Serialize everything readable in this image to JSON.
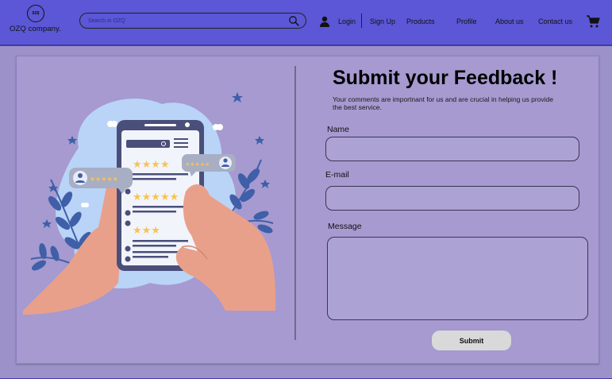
{
  "header": {
    "logo": {
      "mark_text": "OZQ",
      "name": "OZQ company."
    },
    "search": {
      "placeholder": "Search in OZQ"
    },
    "nav": {
      "login": "Login",
      "signup": "Sign Up",
      "products": "Products",
      "profile": "Profile",
      "about": "About us",
      "contact": "Contact us"
    },
    "icons": {
      "search": "search-icon",
      "user": "user-icon",
      "cart": "cart-icon"
    }
  },
  "form": {
    "title": "Submit your Feedback !",
    "subtitle": "Your comments are importnant for us and are crucial in helping us provide the best service.",
    "name_label": "Name",
    "name_value": "",
    "email_label": "E-mail",
    "email_value": "",
    "message_label": "Message",
    "message_value": "",
    "submit_label": "Submit"
  },
  "colors": {
    "header_bg": "#5b57d6",
    "page_bg": "#9c92c9",
    "panel_bg": "#a69ad0",
    "input_bg": "#aca2d4",
    "button_bg": "#d9d9d9",
    "star": "#f6c453",
    "hand": "#e9a08a",
    "phone": "#4a4f7a",
    "leaf": "#3f5fa8",
    "blob": "#b9d4f7"
  }
}
